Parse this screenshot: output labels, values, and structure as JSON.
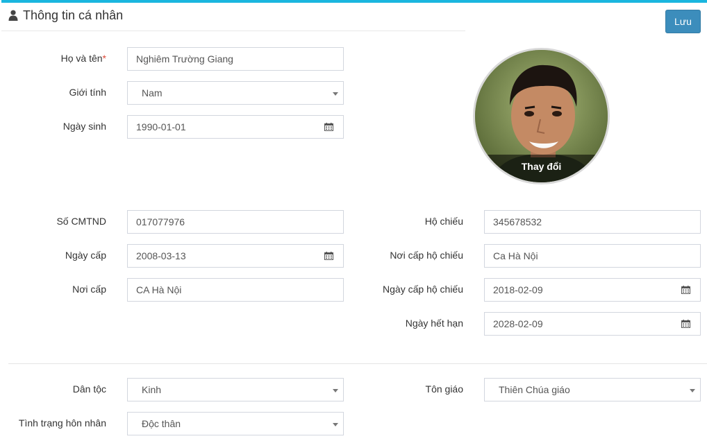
{
  "header": {
    "title": "Thông tin cá nhân",
    "icon": "user-icon",
    "save_label": "Lưu"
  },
  "colors": {
    "accent_bar": "#1ab6df",
    "save_button": "#3c8dbc",
    "required": "#dd4b39"
  },
  "personal": {
    "full_name_label": "Họ và tên",
    "full_name_required": "*",
    "full_name_value": "Nghiêm Trường Giang",
    "gender_label": "Giới tính",
    "gender_value": "Nam",
    "dob_label": "Ngày sinh",
    "dob_value": "1990-01-01"
  },
  "avatar": {
    "change_label": "Thay đổi"
  },
  "id_card": {
    "number_label": "Số CMTND",
    "number_value": "017077976",
    "issue_date_label": "Ngày cấp",
    "issue_date_value": "2008-03-13",
    "issue_place_label": "Nơi cấp",
    "issue_place_value": "CA Hà Nội"
  },
  "passport": {
    "number_label": "Hộ chiếu",
    "number_value": "345678532",
    "issue_place_label": "Nơi cấp hộ chiếu",
    "issue_place_value": "Ca Hà Nội",
    "issue_date_label": "Ngày cấp hộ chiếu",
    "issue_date_value": "2018-02-09",
    "expiry_label": "Ngày hết hạn",
    "expiry_value": "2028-02-09"
  },
  "other": {
    "ethnicity_label": "Dân tộc",
    "ethnicity_value": "Kinh",
    "religion_label": "Tôn giáo",
    "religion_value": "Thiên Chúa giáo",
    "marital_label": "Tình trạng hôn nhân",
    "marital_value": "Độc thân"
  }
}
